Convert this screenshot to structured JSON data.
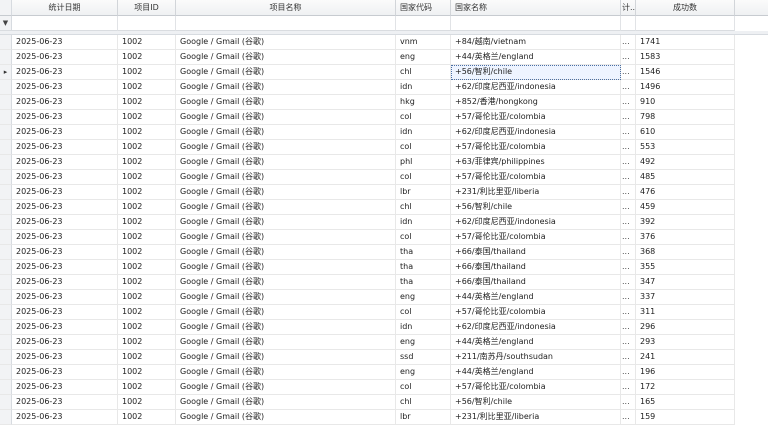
{
  "columns": [
    "统计日期",
    "项目ID",
    "项目名称",
    "国家代码",
    "国家名称",
    "计...",
    "成功数"
  ],
  "filter_icon": "▼",
  "row_indicator": "▸",
  "rows": [
    {
      "date": "2025-06-23",
      "pid": "1002",
      "name": "Google / Gmail (谷歌)",
      "code": "vnm",
      "country": "+84/越南/vietnam",
      "calc": "...",
      "success": "1741"
    },
    {
      "date": "2025-06-23",
      "pid": "1002",
      "name": "Google / Gmail (谷歌)",
      "code": "eng",
      "country": "+44/英格兰/england",
      "calc": "...",
      "success": "1583"
    },
    {
      "date": "2025-06-23",
      "pid": "1002",
      "name": "Google / Gmail (谷歌)",
      "code": "chl",
      "country": "+56/智利/chile",
      "calc": "...",
      "success": "1546"
    },
    {
      "date": "2025-06-23",
      "pid": "1002",
      "name": "Google / Gmail (谷歌)",
      "code": "idn",
      "country": "+62/印度尼西亚/indonesia",
      "calc": "...",
      "success": "1496"
    },
    {
      "date": "2025-06-23",
      "pid": "1002",
      "name": "Google / Gmail (谷歌)",
      "code": "hkg",
      "country": "+852/香港/hongkong",
      "calc": "...",
      "success": "910"
    },
    {
      "date": "2025-06-23",
      "pid": "1002",
      "name": "Google / Gmail (谷歌)",
      "code": "col",
      "country": "+57/哥伦比亚/colombia",
      "calc": "...",
      "success": "798"
    },
    {
      "date": "2025-06-23",
      "pid": "1002",
      "name": "Google / Gmail (谷歌)",
      "code": "idn",
      "country": "+62/印度尼西亚/indonesia",
      "calc": "...",
      "success": "610"
    },
    {
      "date": "2025-06-23",
      "pid": "1002",
      "name": "Google / Gmail (谷歌)",
      "code": "col",
      "country": "+57/哥伦比亚/colombia",
      "calc": "...",
      "success": "553"
    },
    {
      "date": "2025-06-23",
      "pid": "1002",
      "name": "Google / Gmail (谷歌)",
      "code": "phl",
      "country": "+63/菲律宾/philippines",
      "calc": "...",
      "success": "492"
    },
    {
      "date": "2025-06-23",
      "pid": "1002",
      "name": "Google / Gmail (谷歌)",
      "code": "col",
      "country": "+57/哥伦比亚/colombia",
      "calc": "...",
      "success": "485"
    },
    {
      "date": "2025-06-23",
      "pid": "1002",
      "name": "Google / Gmail (谷歌)",
      "code": "lbr",
      "country": "+231/利比里亚/liberia",
      "calc": "...",
      "success": "476"
    },
    {
      "date": "2025-06-23",
      "pid": "1002",
      "name": "Google / Gmail (谷歌)",
      "code": "chl",
      "country": "+56/智利/chile",
      "calc": "...",
      "success": "459"
    },
    {
      "date": "2025-06-23",
      "pid": "1002",
      "name": "Google / Gmail (谷歌)",
      "code": "idn",
      "country": "+62/印度尼西亚/indonesia",
      "calc": "...",
      "success": "392"
    },
    {
      "date": "2025-06-23",
      "pid": "1002",
      "name": "Google / Gmail (谷歌)",
      "code": "col",
      "country": "+57/哥伦比亚/colombia",
      "calc": "...",
      "success": "376"
    },
    {
      "date": "2025-06-23",
      "pid": "1002",
      "name": "Google / Gmail (谷歌)",
      "code": "tha",
      "country": "+66/泰国/thailand",
      "calc": "...",
      "success": "368"
    },
    {
      "date": "2025-06-23",
      "pid": "1002",
      "name": "Google / Gmail (谷歌)",
      "code": "tha",
      "country": "+66/泰国/thailand",
      "calc": "...",
      "success": "355"
    },
    {
      "date": "2025-06-23",
      "pid": "1002",
      "name": "Google / Gmail (谷歌)",
      "code": "tha",
      "country": "+66/泰国/thailand",
      "calc": "...",
      "success": "347"
    },
    {
      "date": "2025-06-23",
      "pid": "1002",
      "name": "Google / Gmail (谷歌)",
      "code": "eng",
      "country": "+44/英格兰/england",
      "calc": "...",
      "success": "337"
    },
    {
      "date": "2025-06-23",
      "pid": "1002",
      "name": "Google / Gmail (谷歌)",
      "code": "col",
      "country": "+57/哥伦比亚/colombia",
      "calc": "...",
      "success": "311"
    },
    {
      "date": "2025-06-23",
      "pid": "1002",
      "name": "Google / Gmail (谷歌)",
      "code": "idn",
      "country": "+62/印度尼西亚/indonesia",
      "calc": "...",
      "success": "296"
    },
    {
      "date": "2025-06-23",
      "pid": "1002",
      "name": "Google / Gmail (谷歌)",
      "code": "eng",
      "country": "+44/英格兰/england",
      "calc": "...",
      "success": "293"
    },
    {
      "date": "2025-06-23",
      "pid": "1002",
      "name": "Google / Gmail (谷歌)",
      "code": "ssd",
      "country": "+211/南苏丹/southsudan",
      "calc": "...",
      "success": "241"
    },
    {
      "date": "2025-06-23",
      "pid": "1002",
      "name": "Google / Gmail (谷歌)",
      "code": "eng",
      "country": "+44/英格兰/england",
      "calc": "...",
      "success": "196"
    },
    {
      "date": "2025-06-23",
      "pid": "1002",
      "name": "Google / Gmail (谷歌)",
      "code": "col",
      "country": "+57/哥伦比亚/colombia",
      "calc": "...",
      "success": "172"
    },
    {
      "date": "2025-06-23",
      "pid": "1002",
      "name": "Google / Gmail (谷歌)",
      "code": "chl",
      "country": "+56/智利/chile",
      "calc": "...",
      "success": "165"
    },
    {
      "date": "2025-06-23",
      "pid": "1002",
      "name": "Google / Gmail (谷歌)",
      "code": "lbr",
      "country": "+231/利比里亚/liberia",
      "calc": "...",
      "success": "159"
    }
  ],
  "selected_row": 2
}
